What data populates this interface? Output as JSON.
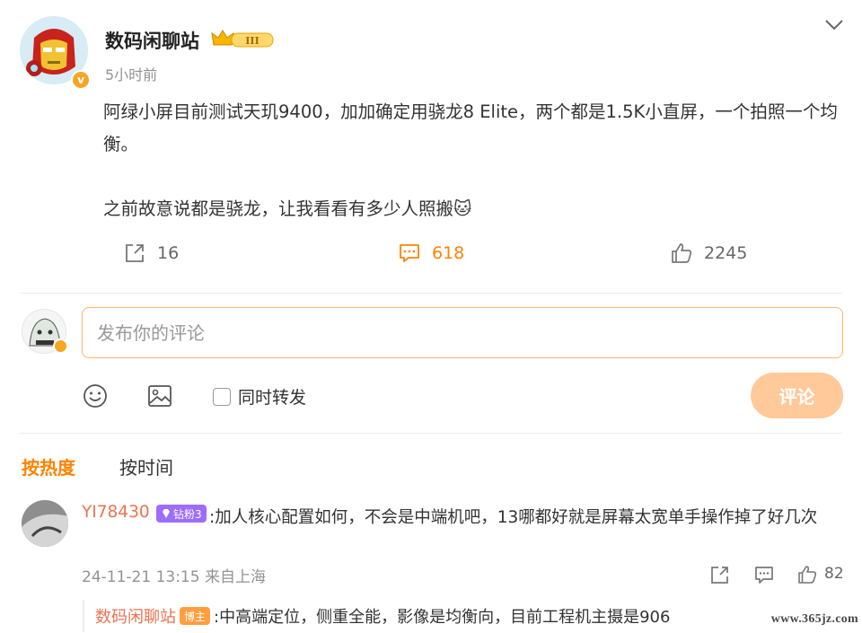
{
  "post": {
    "username": "数码闲聊站",
    "level_badge": "III",
    "time": "5小时前",
    "paragraphs": [
      "阿绿小屏目前测试天玑9400，加加确定用骁龙8 Elite，两个都是1.5K小直屏，一个拍照一个均衡。",
      "之前故意说都是骁龙，让我看看有多少人照搬🐱"
    ],
    "repost_count": "16",
    "comment_count": "618",
    "like_count": "2245"
  },
  "composer": {
    "placeholder": "发布你的评论",
    "repost_label": "同时转发",
    "submit_label": "评论"
  },
  "sort": {
    "hot": "按热度",
    "time": "按时间"
  },
  "comments": [
    {
      "user": "YI78430",
      "badge": "钻粉3",
      "text": ":加人核心配置如何，不会是中端机吧，13哪都好就是屏幕太宽单手操作掉了好几次",
      "meta": "24-11-21 13:15 来自上海",
      "likes": "82",
      "reply": {
        "user": "数码闲聊站",
        "badge": "博主",
        "text": ":中高端定位，侧重全能，影像是均衡向，目前工程机主摄是906"
      }
    }
  ],
  "watermark": "www.365jz.com",
  "colors": {
    "accent": "#ff8200",
    "username_link": "#eb7350",
    "submit_disabled": "#ffc99a"
  }
}
